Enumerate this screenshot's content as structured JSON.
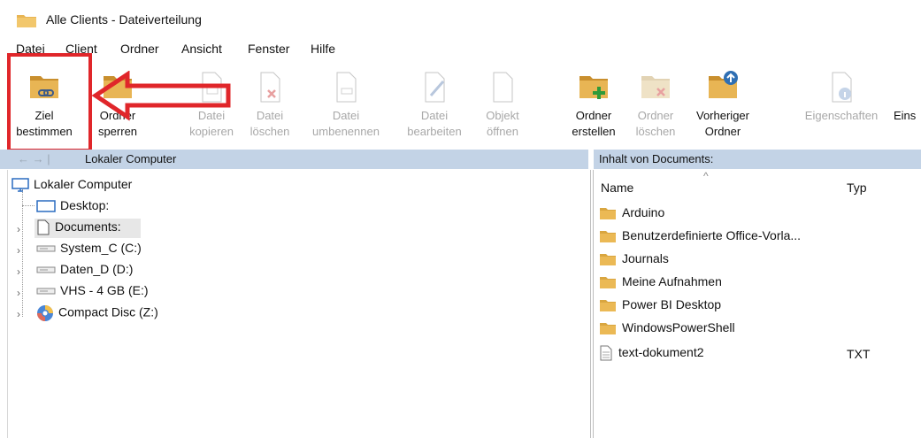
{
  "window": {
    "title": "Alle Clients - Dateiverteilung"
  },
  "menu": [
    "Datei",
    "Client",
    "Ordner",
    "Ansicht",
    "Fenster",
    "Hilfe"
  ],
  "toolbar": [
    {
      "label": "Ziel\nbestimmen",
      "enabled": true,
      "icon": "folder-link-icon"
    },
    {
      "label": "Ordner\nsperren",
      "enabled": true,
      "icon": "folder-lock-icon"
    },
    {
      "label": "Datei\nkopieren",
      "enabled": false,
      "icon": "file-copy-icon"
    },
    {
      "label": "Datei\nlöschen",
      "enabled": false,
      "icon": "file-delete-icon"
    },
    {
      "label": "Datei\numbenennen",
      "enabled": false,
      "icon": "file-rename-icon"
    },
    {
      "label": "Datei\nbearbeiten",
      "enabled": false,
      "icon": "file-edit-icon"
    },
    {
      "label": "Objekt\nöffnen",
      "enabled": false,
      "icon": "file-open-icon"
    },
    {
      "label": "Ordner\nerstellen",
      "enabled": true,
      "icon": "folder-add-icon"
    },
    {
      "label": "Ordner\nlöschen",
      "enabled": false,
      "icon": "folder-delete-icon"
    },
    {
      "label": "Vorheriger\nOrdner",
      "enabled": true,
      "icon": "folder-up-icon"
    },
    {
      "label": "Eigenschaften",
      "enabled": false,
      "icon": "properties-icon"
    },
    {
      "label": "Eins",
      "enabled": true,
      "icon": ""
    }
  ],
  "nav": {
    "left": "Lokaler Computer",
    "right": "Inhalt von Documents:"
  },
  "tree": {
    "root": "Lokaler Computer",
    "items": [
      "Desktop:",
      "Documents:",
      "System_C (C:)",
      "Daten_D (D:)",
      "VHS - 4 GB (E:)",
      "Compact Disc (Z:)"
    ]
  },
  "list": {
    "columns": [
      "Name",
      "Typ"
    ],
    "rows": [
      {
        "name": "Arduino",
        "type": "",
        "kind": "folder"
      },
      {
        "name": "Benutzerdefinierte Office-Vorla...",
        "type": "",
        "kind": "folder"
      },
      {
        "name": "Journals",
        "type": "",
        "kind": "folder"
      },
      {
        "name": "Meine Aufnahmen",
        "type": "",
        "kind": "folder"
      },
      {
        "name": "Power BI Desktop",
        "type": "",
        "kind": "folder"
      },
      {
        "name": "WindowsPowerShell",
        "type": "",
        "kind": "folder"
      },
      {
        "name": "text-dokument2",
        "type": "TXT",
        "kind": "file"
      }
    ]
  },
  "colors": {
    "accent": "#e0262a",
    "navbar": "#c3d3e6",
    "folder": "#e8b554"
  }
}
